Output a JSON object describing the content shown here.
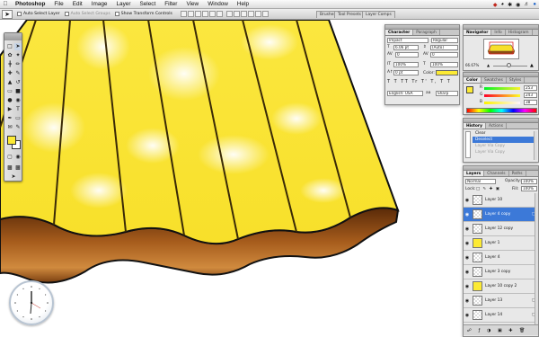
{
  "menubar": {
    "app": "Photoshop",
    "items": [
      "File",
      "Edit",
      "Image",
      "Layer",
      "Select",
      "Filter",
      "View",
      "Window",
      "Help"
    ]
  },
  "options_bar": {
    "auto_select_layer": "Auto Select Layer",
    "auto_select_groups": "Auto Select Groups",
    "show_transform_controls": "Show Transform Controls"
  },
  "well_tabs": {
    "brushes": "Brushes",
    "tool_presets": "Tool Presets",
    "layer_comps": "Layer Comps"
  },
  "character_panel": {
    "tabs": [
      "Character",
      "Paragraph"
    ],
    "font_family": "Impact",
    "font_style": "Regular",
    "font_size": "6.06 pt",
    "leading": "(Auto)",
    "kerning": "0",
    "tracking": "0",
    "vertical_scale": "100%",
    "horizontal_scale": "100%",
    "baseline_shift": "0 pt",
    "color_label": "Color:",
    "language": "English: USA",
    "antialias": "Sharp"
  },
  "navigator_panel": {
    "tabs": [
      "Navigator",
      "Info",
      "Histogram"
    ],
    "zoom": "66.67%"
  },
  "color_panel": {
    "tabs": [
      "Color",
      "Swatches",
      "Styles"
    ],
    "r_label": "R",
    "g_label": "G",
    "b_label": "B",
    "r": "253",
    "g": "243",
    "b": "38",
    "fg_color": "#fcea34"
  },
  "history_panel": {
    "tabs": [
      "History",
      "Actions"
    ],
    "items": [
      {
        "label": "Clear",
        "state": "normal"
      },
      {
        "label": "Deselect",
        "state": "selected"
      },
      {
        "label": "Layer Via Copy",
        "state": "dim"
      },
      {
        "label": "Layer Via Copy",
        "state": "dim"
      }
    ]
  },
  "layers_panel": {
    "tabs": [
      "Layers",
      "Channels",
      "Paths"
    ],
    "blend_mode": "Normal",
    "opacity_label": "Opacity:",
    "opacity": "100%",
    "lock_label": "Lock:",
    "fill_label": "Fill:",
    "fill": "100%",
    "layers": [
      {
        "name": "Layer 10",
        "selected": false,
        "visible": true
      },
      {
        "name": "Layer 4 copy",
        "selected": true,
        "visible": true
      },
      {
        "name": "Layer 12 copy",
        "selected": false,
        "visible": true
      },
      {
        "name": "Layer 1",
        "selected": false,
        "visible": true
      },
      {
        "name": "Layer 4",
        "selected": false,
        "visible": true
      },
      {
        "name": "Layer 3 copy",
        "selected": false,
        "visible": true
      },
      {
        "name": "Layer 10 copy 2",
        "selected": false,
        "visible": true
      },
      {
        "name": "Layer 13",
        "selected": false,
        "visible": true
      },
      {
        "name": "Layer 14",
        "selected": false,
        "visible": true
      }
    ]
  },
  "colors": {
    "yellow": "#fbe83a",
    "brown": "#8a4a14",
    "selection": "#3c79d8"
  }
}
